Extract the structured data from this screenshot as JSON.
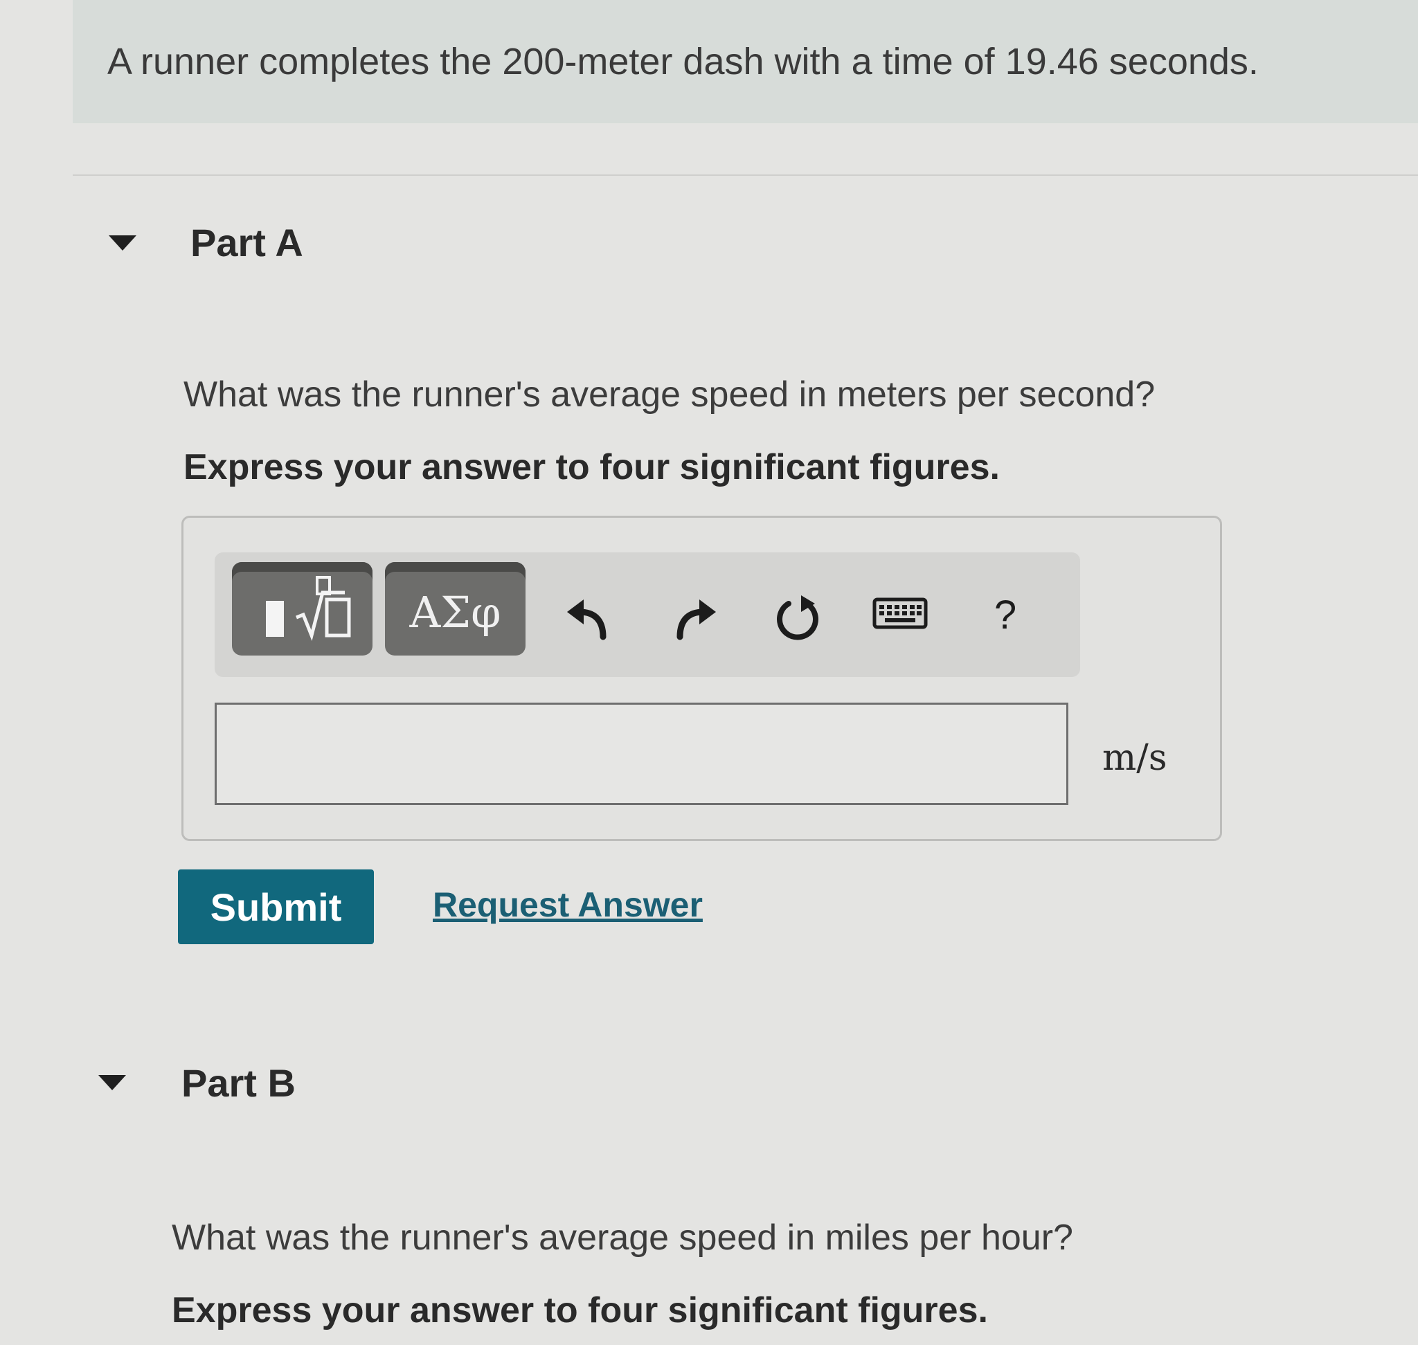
{
  "problem": {
    "text": "A runner completes the 200-meter dash with a time of 19.46 seconds."
  },
  "part_a": {
    "title": "Part A",
    "question": "What was the runner's average speed in meters per second?",
    "instruction": "Express your answer to four significant figures.",
    "toolbar": {
      "templates_icon": "templates-radical-icon",
      "symbols_label": "ΑΣφ",
      "undo_icon": "undo-icon",
      "redo_icon": "redo-icon",
      "reset_icon": "reset-icon",
      "keyboard_icon": "keyboard-icon",
      "help_label": "?"
    },
    "answer_value": "",
    "units": "m/s",
    "submit_label": "Submit",
    "request_answer_label": "Request Answer"
  },
  "part_b": {
    "title": "Part B",
    "question": "What was the runner's average speed in miles per hour?",
    "instruction": "Express your answer to four significant figures."
  },
  "colors": {
    "submit_bg": "#11687d",
    "link": "#1b5f74",
    "banner_bg": "#d7dcd9",
    "toolbar_button": "#6d6d6b"
  }
}
